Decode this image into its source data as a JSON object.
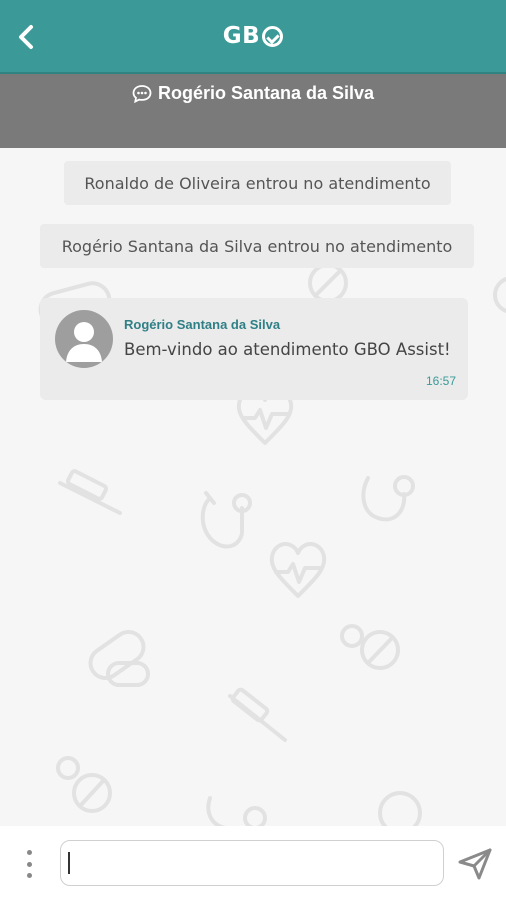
{
  "header": {
    "logo_text": "GB",
    "back_icon": "chevron-left-icon"
  },
  "subheader": {
    "contact_name": "Rogério Santana da Silva",
    "chat_icon": "chat-bubble-icon"
  },
  "messages": {
    "system": [
      "Ronaldo de Oliveira entrou no atendimento",
      "Rogério Santana da Silva entrou no atendimento"
    ],
    "chat": {
      "sender": "Rogério Santana da Silva",
      "text": "Bem-vindo ao atendimento GBO Assist!",
      "time": "16:57"
    }
  },
  "composer": {
    "value": "",
    "placeholder": ""
  },
  "colors": {
    "accent": "#3b9a98",
    "subheader": "#7a7a7a",
    "background": "#f6f6f6"
  }
}
